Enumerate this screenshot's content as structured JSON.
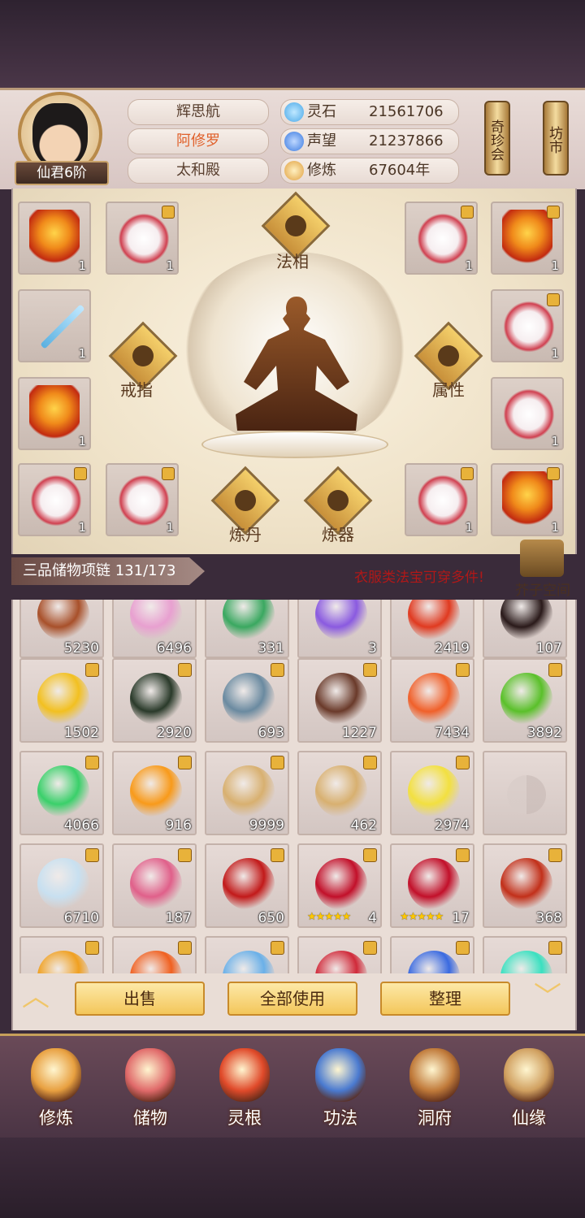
{
  "player": {
    "name": "辉思航",
    "title": "阿修罗",
    "location": "太和殿",
    "rank": "仙君6阶"
  },
  "stats": [
    {
      "label": "灵石",
      "value": "21561706",
      "icon": "spirit-stone-icon",
      "color": "#4aa8e8"
    },
    {
      "label": "声望",
      "value": "21237866",
      "icon": "reputation-icon",
      "color": "#3a7ae0"
    },
    {
      "label": "修炼",
      "value": "67604年",
      "icon": "cultivation-icon",
      "color": "#e0a040"
    }
  ],
  "side_buttons": {
    "treasure_fair": "奇珍会",
    "market": "坊市"
  },
  "equipment": {
    "labels": {
      "dharma": "法相",
      "ring": "戒指",
      "attribute": "属性",
      "alchemy": "炼丹",
      "forging": "炼器"
    },
    "slots": [
      {
        "count": "1",
        "type": "robe-red",
        "locked": false
      },
      {
        "count": "1",
        "type": "robe-white",
        "locked": true
      },
      {
        "count": "1",
        "type": "robe-white",
        "locked": true
      },
      {
        "count": "1",
        "type": "robe-red",
        "locked": true
      },
      {
        "count": "1",
        "type": "sword",
        "locked": false
      },
      {
        "count": "1",
        "type": "robe-white",
        "locked": true
      },
      {
        "count": "1",
        "type": "robe-red",
        "locked": false
      },
      {
        "count": "1",
        "type": "robe-white",
        "locked": false
      },
      {
        "count": "1",
        "type": "robe-white",
        "locked": true
      },
      {
        "count": "1",
        "type": "robe-white",
        "locked": true
      },
      {
        "count": "1",
        "type": "robe-white",
        "locked": true
      },
      {
        "count": "1",
        "type": "robe-red",
        "locked": true
      }
    ]
  },
  "inventory": {
    "tag": "三品储物项链 131/173",
    "hint": "衣服类法宝可穿多件!",
    "mustard_space": "芥子空间",
    "items": [
      {
        "count": "5230",
        "color": "#a8502a",
        "locked": false
      },
      {
        "count": "6496",
        "color": "#e8a0d0",
        "locked": false
      },
      {
        "count": "331",
        "color": "#3aa860",
        "locked": false
      },
      {
        "count": "3",
        "color": "#8a5ae0",
        "locked": false
      },
      {
        "count": "2419",
        "color": "#e03a20",
        "locked": false
      },
      {
        "count": "107",
        "color": "#2a1a1a",
        "locked": false
      },
      {
        "count": "1502",
        "color": "#f2c020",
        "locked": true
      },
      {
        "count": "2920",
        "color": "#2a3a2a",
        "locked": true
      },
      {
        "count": "693",
        "color": "#6a8aa0",
        "locked": true
      },
      {
        "count": "1227",
        "color": "#6a3a2a",
        "locked": true
      },
      {
        "count": "7434",
        "color": "#f0602a",
        "locked": true
      },
      {
        "count": "3892",
        "color": "#5ac02a",
        "locked": true
      },
      {
        "count": "4066",
        "color": "#3ad06a",
        "locked": true
      },
      {
        "count": "916",
        "color": "#f89a1a",
        "locked": true
      },
      {
        "count": "9999",
        "color": "#d8b070",
        "locked": true
      },
      {
        "count": "462",
        "color": "#d8b070",
        "locked": true
      },
      {
        "count": "2974",
        "color": "#f2e040",
        "locked": true
      },
      {
        "count": "",
        "color": "",
        "locked": false
      },
      {
        "count": "6710",
        "color": "#c8e0f0",
        "locked": true
      },
      {
        "count": "187",
        "color": "#e0608a",
        "locked": true
      },
      {
        "count": "650",
        "color": "#c21a1a",
        "locked": true
      },
      {
        "count": "4",
        "color": "#c2102a",
        "locked": true,
        "stars": "★★★★★"
      },
      {
        "count": "17",
        "color": "#c2102a",
        "locked": true,
        "stars": "★★★★★"
      },
      {
        "count": "368",
        "color": "#c2301a",
        "locked": true
      },
      {
        "count": "",
        "color": "#f0a020",
        "locked": true
      },
      {
        "count": "",
        "color": "#f06020",
        "locked": true
      },
      {
        "count": "",
        "color": "#6ab0e8",
        "locked": true
      },
      {
        "count": "",
        "color": "#d02a3a",
        "locked": true
      },
      {
        "count": "",
        "color": "#3a6ae0",
        "locked": true
      },
      {
        "count": "",
        "color": "#3ae0c0",
        "locked": true
      }
    ]
  },
  "actions": {
    "sell": "出售",
    "use_all": "全部使用",
    "sort": "整理"
  },
  "nav": [
    {
      "label": "修炼",
      "icon": "cultivate-icon",
      "color": "#e8a040"
    },
    {
      "label": "储物",
      "icon": "storage-bag-icon",
      "color": "#e06a6a"
    },
    {
      "label": "灵根",
      "icon": "spirit-root-icon",
      "color": "#e04a2a"
    },
    {
      "label": "功法",
      "icon": "technique-book-icon",
      "color": "#4a7ad0"
    },
    {
      "label": "洞府",
      "icon": "cave-residence-icon",
      "color": "#c07a3a"
    },
    {
      "label": "仙缘",
      "icon": "immortal-fate-icon",
      "color": "#d0a060"
    }
  ]
}
